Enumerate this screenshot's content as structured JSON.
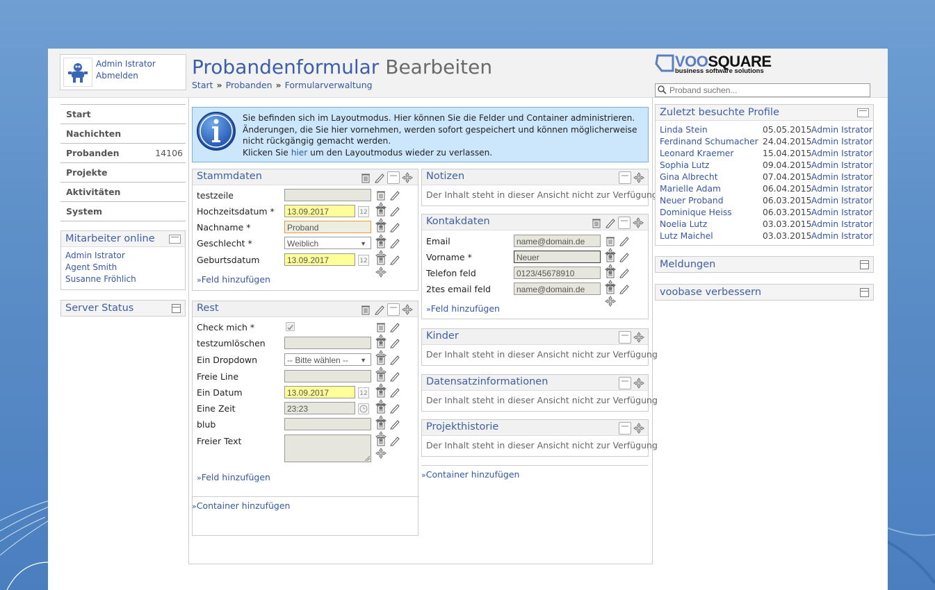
{
  "user": {
    "name": "Admin Istrator",
    "logout": "Abmelden"
  },
  "title": {
    "main": "Probandenformular",
    "sub": "Bearbeiten"
  },
  "breadcrumb": [
    "Start",
    "Probanden",
    "Formularverwaltung"
  ],
  "logo": {
    "voo": "VOO",
    "square": "SQUARE",
    "tagline": "business software solutions"
  },
  "search": {
    "placeholder": "Proband suchen..."
  },
  "nav": [
    {
      "label": "Start",
      "count": ""
    },
    {
      "label": "Nachichten",
      "count": ""
    },
    {
      "label": "Probanden",
      "count": "14106"
    },
    {
      "label": "Projekte",
      "count": ""
    },
    {
      "label": "Aktivitäten",
      "count": ""
    },
    {
      "label": "System",
      "count": ""
    }
  ],
  "online": {
    "title": "Mitarbeiter online",
    "users": [
      "Admin Istrator",
      "Agent Smith",
      "Susanne Fröhlich"
    ]
  },
  "server_status": {
    "title": "Server Status"
  },
  "info": {
    "line1": "Sie befinden sich im Layoutmodus. Hier können Sie die Felder und Container administrieren.",
    "line2": "Änderungen, die Sie hier vornehmen, werden sofort gespeichert und können möglicherweise nicht rückgängig gemacht werden.",
    "line3_pre": "Klicken Sie ",
    "line3_link": "hier",
    "line3_post": " um den Layoutmodus wieder zu verlassen."
  },
  "stammdaten": {
    "title": "Stammdaten",
    "fields": [
      {
        "label": "testzeile",
        "value": ""
      },
      {
        "label": "Hochzeitsdatum *",
        "value": "13.09.2017"
      },
      {
        "label": "Nachname *",
        "value": "Proband"
      },
      {
        "label": "Geschlecht *",
        "value": "Weiblich"
      },
      {
        "label": "Geburtsdatum",
        "value": "13.09.2017"
      }
    ],
    "add": "Feld hinzufügen"
  },
  "rest": {
    "title": "Rest",
    "fields": [
      {
        "label": "Check mich *",
        "value": ""
      },
      {
        "label": "testzumlöschen",
        "value": ""
      },
      {
        "label": "Ein Dropdown",
        "value": "-- Bitte wählen --"
      },
      {
        "label": "Freie Line",
        "value": ""
      },
      {
        "label": "Ein Datum",
        "value": "13.09.2017"
      },
      {
        "label": "Eine Zeit",
        "value": "23:23"
      },
      {
        "label": "blub",
        "value": ""
      },
      {
        "label": "Freier Text",
        "value": ""
      }
    ],
    "add": "Feld hinzufügen"
  },
  "container_add": "Container hinzufügen",
  "notizen": {
    "title": "Notizen",
    "text": "Der Inhalt steht in dieser Ansicht nicht zur Verfügung"
  },
  "kontakt": {
    "title": "Kontakdaten",
    "fields": [
      {
        "label": "Email",
        "value": "name@domain.de"
      },
      {
        "label": "Vorname *",
        "value": "Neuer"
      },
      {
        "label": "Telefon feld",
        "value": "0123/45678910"
      },
      {
        "label": "2tes email feld",
        "value": "name@domain.de"
      }
    ],
    "add": "Feld hinzufügen"
  },
  "kinder": {
    "title": "Kinder",
    "text": "Der Inhalt steht in dieser Ansicht nicht zur Verfügung"
  },
  "datensatz": {
    "title": "Datensatzinformationen",
    "text": "Der Inhalt steht in dieser Ansicht nicht zur Verfügung"
  },
  "projekt": {
    "title": "Projekthistorie",
    "text": "Der Inhalt steht in dieser Ansicht nicht zur Verfügung"
  },
  "recent": {
    "title": "Zuletzt besuchte Profile",
    "rows": [
      {
        "name": "Linda Stein",
        "date": "05.05.2015",
        "user": "Admin Istrator"
      },
      {
        "name": "Ferdinand Schumacher",
        "date": "24.04.2015",
        "user": "Admin Istrator"
      },
      {
        "name": "Leonard Kraemer",
        "date": "15.04.2015",
        "user": "Admin Istrator"
      },
      {
        "name": "Sophia Lutz",
        "date": "09.04.2015",
        "user": "Admin Istrator"
      },
      {
        "name": "Gina Albrecht",
        "date": "07.04.2015",
        "user": "Admin Istrator"
      },
      {
        "name": "Marielle Adam",
        "date": "06.04.2015",
        "user": "Admin Istrator"
      },
      {
        "name": "Neuer Proband",
        "date": "06.03.2015",
        "user": "Admin Istrator"
      },
      {
        "name": "Dominique Heiss",
        "date": "06.03.2015",
        "user": "Admin Istrator"
      },
      {
        "name": "Noelia Lutz",
        "date": "03.03.2015",
        "user": "Admin Istrator"
      },
      {
        "name": "Lutz Maichel",
        "date": "03.03.2015",
        "user": "Admin Istrator"
      }
    ]
  },
  "meldungen": {
    "title": "Meldungen"
  },
  "verbessern": {
    "title": "voobase verbessern"
  }
}
